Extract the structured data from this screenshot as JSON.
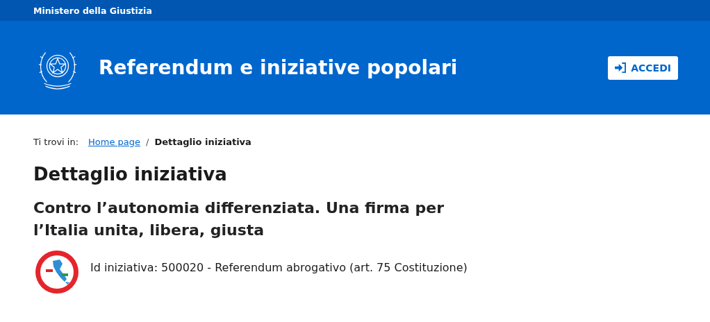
{
  "top_bar": {
    "label": "Ministero della Giustizia"
  },
  "header": {
    "title": "Referendum e iniziative popolari",
    "login_button": "ACCEDI"
  },
  "breadcrumb": {
    "prefix": "Ti trovi in:",
    "items": [
      {
        "label": "Home page",
        "kind": "link"
      },
      {
        "label": "Dettaglio iniziativa",
        "kind": "current"
      }
    ],
    "separator": "/"
  },
  "page_title": "Dettaglio iniziativa",
  "initiative": {
    "title": "Contro l’autonomia differenziata. Una firma per l’Italia unita, libera, giusta",
    "info": "Id iniziativa: 500020 - Referendum abrogativo (art. 75 Costituzione)"
  }
}
